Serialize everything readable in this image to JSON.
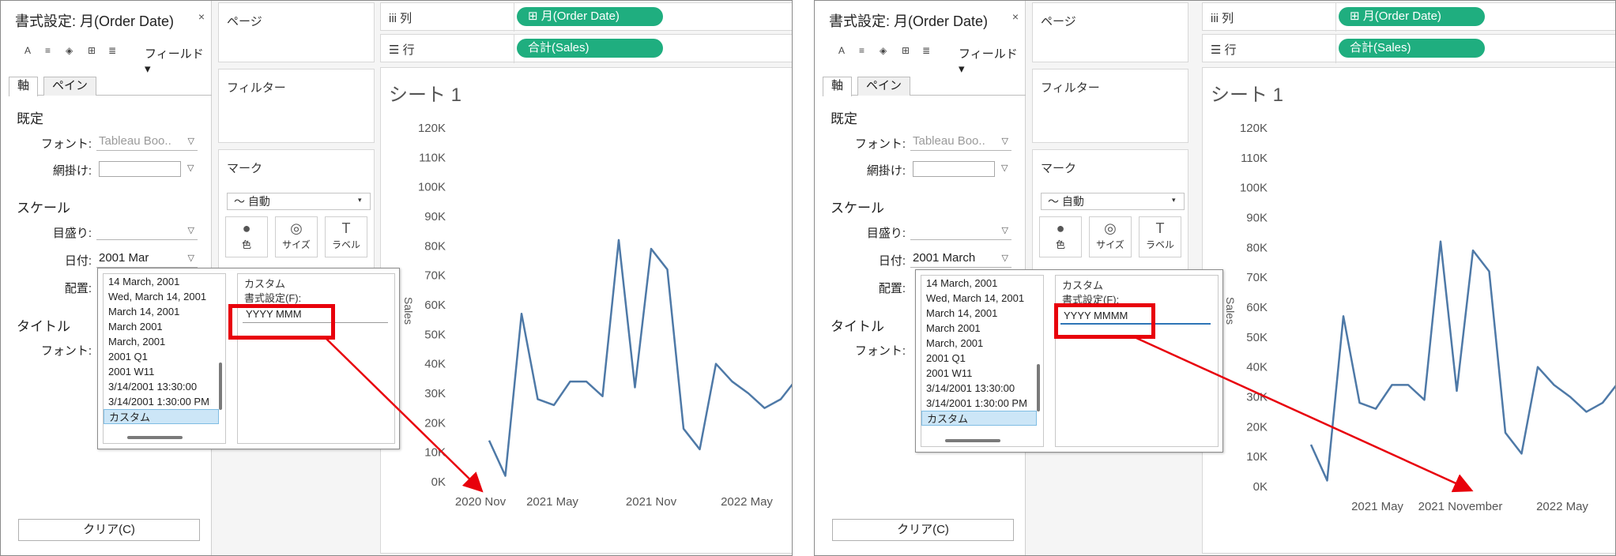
{
  "common": {
    "format_title": "書式設定: 月(Order Date)",
    "close_glyph": "×",
    "toolbar_field": "フィールド▾",
    "tabs": [
      "軸",
      "ペイン"
    ],
    "section_default": "既定",
    "label_font": "フォント:",
    "font_value": "Tableau Boo..",
    "label_shading": "網掛け:",
    "section_scale": "スケール",
    "label_ticks": "目盛り:",
    "label_date": "日付:",
    "label_align": "配置:",
    "section_title": "タイトル",
    "label_title_font": "フォント:",
    "clear_button": "クリア(C)",
    "pages_label": "ページ",
    "filters_label": "フィルター",
    "marks_label": "マーク",
    "mark_type": "〜 自動",
    "mark_buttons": [
      "色",
      "サイズ",
      "ラベル"
    ],
    "columns_label": "iii 列",
    "rows_label": "☰ 行",
    "columns_pill": "⊞ 月(Order Date)",
    "rows_pill": "合計(Sales)",
    "sheet_title": "シート 1",
    "axis_title": "Sales",
    "popup_list": [
      "14 March, 2001",
      "Wed, March 14, 2001",
      "March 14, 2001",
      "March 2001",
      "March, 2001",
      "2001 Q1",
      "2001 W11",
      "3/14/2001 13:30:00",
      "3/14/2001 1:30:00 PM",
      "カスタム"
    ],
    "popup_group": "カスタム",
    "popup_format_label": "書式設定(F):"
  },
  "left": {
    "date_value": "2001 Mar",
    "custom_format": "YYYY MMM"
  },
  "right": {
    "date_value": "2001 March",
    "custom_format": "YYYY MMMM"
  },
  "colors": {
    "pill": "#1fae7f",
    "line": "#4e79a7",
    "highlight": "#e8000b",
    "selection": "#cce6f7"
  },
  "chart_data": [
    {
      "type": "line",
      "x_tick_labels": [
        "2020 Nov",
        "2021 May",
        "2021 Nov",
        "2022 May"
      ],
      "y_tick_labels": [
        "0K",
        "10K",
        "20K",
        "30K",
        "40K",
        "50K",
        "60K",
        "70K",
        "80K",
        "90K",
        "100K",
        "110K",
        "120K"
      ],
      "ylim": [
        0,
        120000
      ],
      "ylabel": "Sales",
      "series": [
        {
          "values": [
            14000,
            2000,
            57000,
            28000,
            26000,
            34000,
            34000,
            29000,
            82000,
            32000,
            79000,
            72000,
            18000,
            11000,
            40000,
            34000,
            30000,
            25000,
            28000,
            35000
          ]
        }
      ]
    },
    {
      "type": "line",
      "x_tick_labels": [
        "2021 May",
        "2021 November",
        "2022 May"
      ],
      "y_tick_labels": [
        "0K",
        "10K",
        "20K",
        "30K",
        "40K",
        "50K",
        "60K",
        "70K",
        "80K",
        "90K",
        "100K",
        "110K",
        "120K"
      ],
      "ylim": [
        0,
        120000
      ],
      "ylabel": "Sales",
      "series": [
        {
          "values": [
            14000,
            2000,
            57000,
            28000,
            26000,
            34000,
            34000,
            29000,
            82000,
            32000,
            79000,
            72000,
            18000,
            11000,
            40000,
            34000,
            30000,
            25000,
            28000,
            35000
          ]
        }
      ]
    }
  ]
}
